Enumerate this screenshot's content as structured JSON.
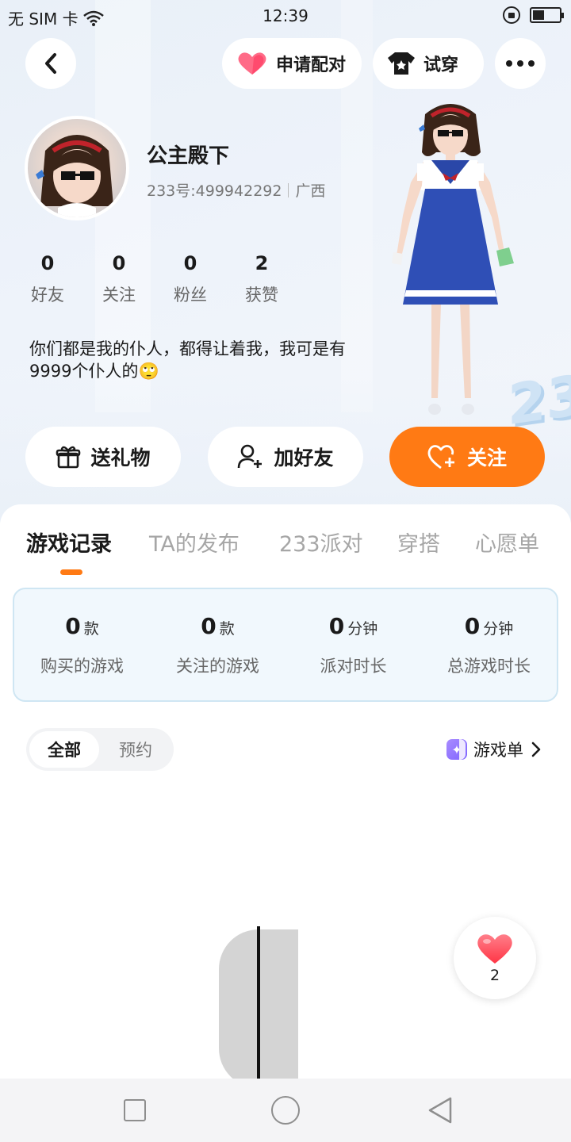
{
  "status_bar": {
    "carrier": "无 SIM 卡",
    "time": "12:39"
  },
  "top_bar": {
    "match_label": "申请配对",
    "tryon_label": "试穿"
  },
  "profile": {
    "name": "公主殿下",
    "id_text": "233号:499942292",
    "region": "广西",
    "bio": "你们都是我的仆人，都得让着我，我可是有9999个仆人的🙄"
  },
  "stats": [
    {
      "value": "0",
      "label": "好友"
    },
    {
      "value": "0",
      "label": "关注"
    },
    {
      "value": "0",
      "label": "粉丝"
    },
    {
      "value": "2",
      "label": "获赞"
    }
  ],
  "actions": {
    "gift": "送礼物",
    "add_friend": "加好友",
    "follow": "关注"
  },
  "tabs": [
    "游戏记录",
    "TA的发布",
    "233派对",
    "穿搭",
    "心愿单"
  ],
  "game_stats": [
    {
      "value": "0",
      "unit": "款",
      "label": "购买的游戏"
    },
    {
      "value": "0",
      "unit": "款",
      "label": "关注的游戏"
    },
    {
      "value": "0",
      "unit": "分钟",
      "label": "派对时长"
    },
    {
      "value": "0",
      "unit": "分钟",
      "label": "总游戏时长"
    }
  ],
  "filter": {
    "all": "全部",
    "reserve": "预约"
  },
  "game_list_link": "游戏单",
  "likes": {
    "count": "2"
  },
  "colors": {
    "accent": "#ff7a14",
    "heart": "#ff4b5c"
  }
}
